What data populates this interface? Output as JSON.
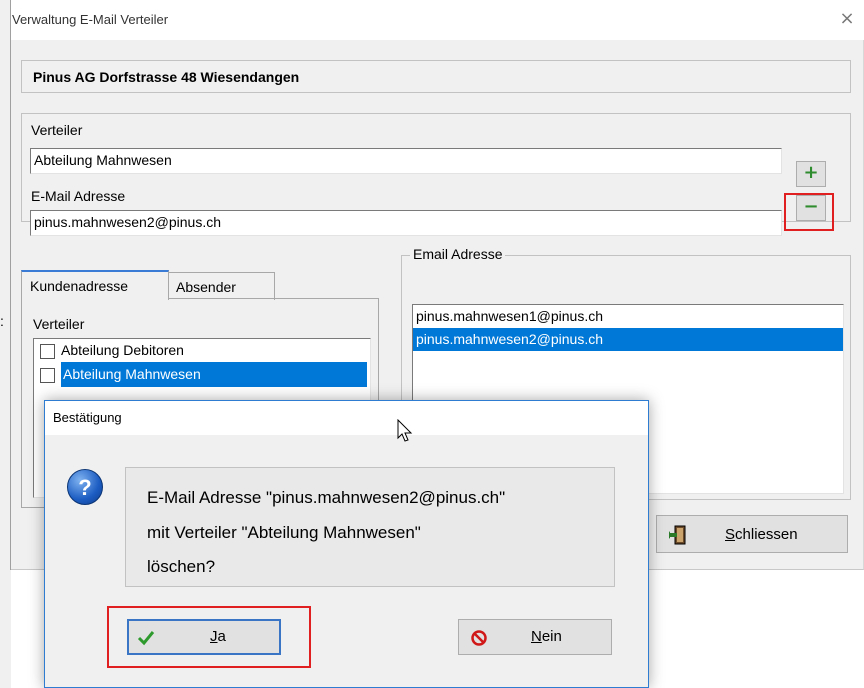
{
  "window": {
    "title": "Verwaltung E-Mail Verteiler",
    "close_glyph": "×"
  },
  "company": {
    "name": "Pinus AG Dorfstrasse 48 Wiesendangen"
  },
  "form": {
    "verteiler_label": "Verteiler",
    "verteiler_value": "Abteilung Mahnwesen",
    "email_label": "E-Mail Adresse",
    "email_value": "pinus.mahnwesen2@pinus.ch",
    "add_button": "+",
    "remove_button": "−"
  },
  "tabs": [
    {
      "label": "Kundenadresse",
      "active": true
    },
    {
      "label": "Absender",
      "active": false
    }
  ],
  "kunden_panel": {
    "verteiler_label": "Verteiler",
    "items": [
      {
        "label": "Abteilung Debitoren",
        "checked": false,
        "selected": false
      },
      {
        "label": "Abteilung Mahnwesen",
        "checked": false,
        "selected": true
      }
    ]
  },
  "email_list": {
    "legend": "Email Adresse",
    "items": [
      {
        "label": "pinus.mahnwesen1@pinus.ch",
        "selected": false
      },
      {
        "label": "pinus.mahnwesen2@pinus.ch",
        "selected": true
      }
    ]
  },
  "schliessen_button": {
    "accel": "S",
    "rest": "chliessen",
    "icon": "exit-door-icon"
  },
  "stray_char": ":",
  "dialog": {
    "title": "Bestätigung",
    "icon": "question-icon",
    "icon_glyph": "?",
    "message_lines": [
      "E-Mail Adresse \"pinus.mahnwesen2@pinus.ch\"",
      "mit Verteiler \"Abteilung Mahnwesen\"",
      "löschen?"
    ],
    "yes_button": {
      "accel": "J",
      "rest": "a",
      "icon": "checkmark-icon"
    },
    "no_button": {
      "accel": "N",
      "rest": "ein",
      "icon": "no-entry-icon"
    }
  },
  "colors": {
    "selection": "#0078d7",
    "highlight_box": "#e02020",
    "dialog_border": "#2e7cd1",
    "plus_minus": "#2e8b2e"
  }
}
